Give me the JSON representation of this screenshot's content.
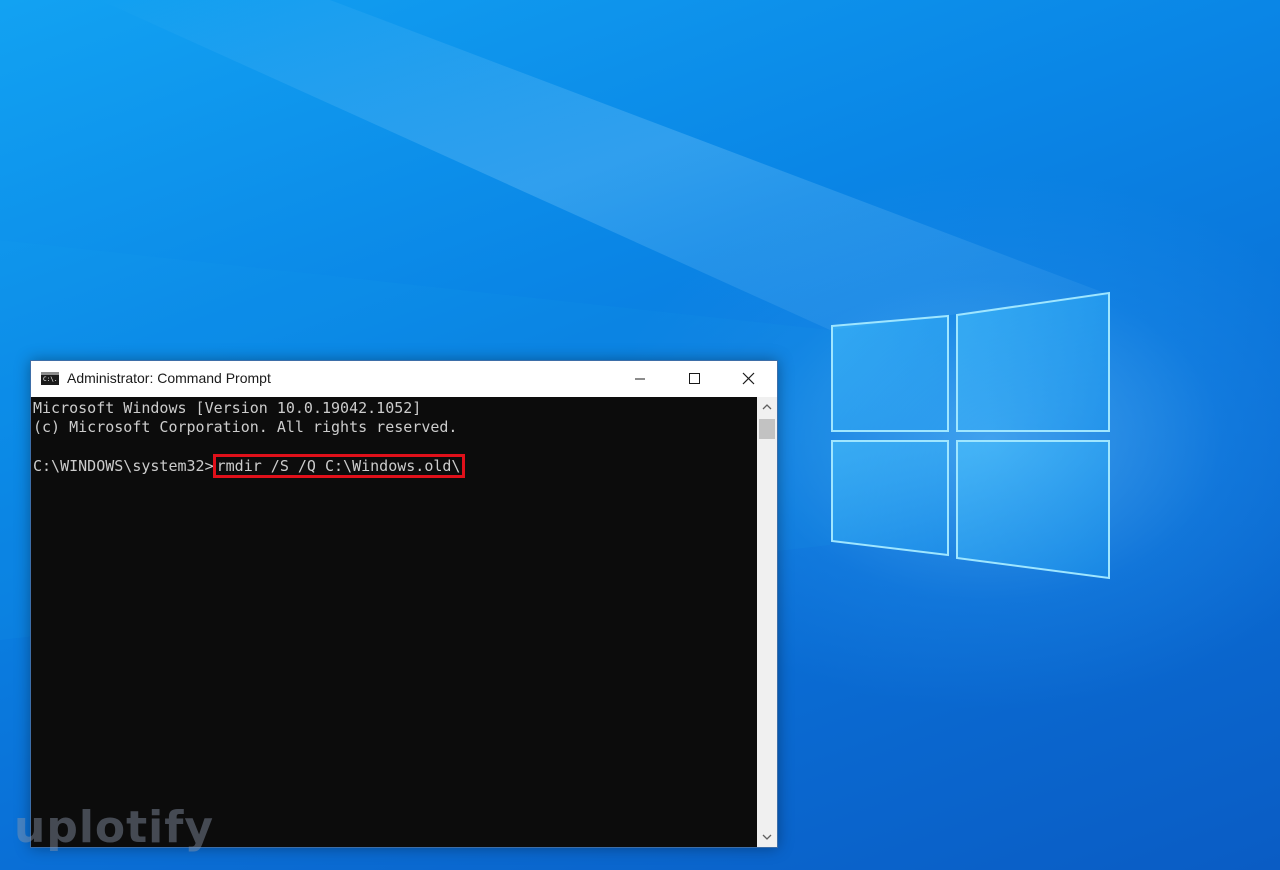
{
  "window": {
    "title": "Administrator: Command Prompt",
    "icon": "cmd-icon",
    "icon_text": "C:\\."
  },
  "titlebar_buttons": {
    "minimize_icon": "minimize-icon",
    "maximize_icon": "maximize-icon",
    "close_icon": "close-icon"
  },
  "console": {
    "line1": "Microsoft Windows [Version 10.0.19042.1052]",
    "line2": "(c) Microsoft Corporation. All rights reserved.",
    "prompt": "C:\\WINDOWS\\system32>",
    "command": "rmdir /S /Q C:\\Windows.old\\"
  },
  "watermark": {
    "text": "uplotify"
  },
  "colors": {
    "console_bg": "#0c0c0c",
    "console_text": "#cccccc",
    "highlight_border": "#e0101a",
    "desktop_blue": "#0a78de"
  }
}
